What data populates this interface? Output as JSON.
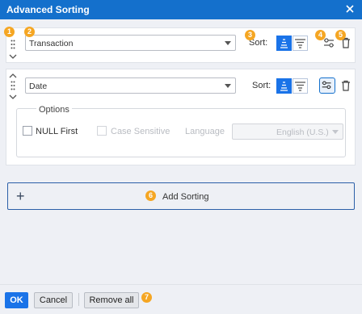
{
  "dialog": {
    "title": "Advanced Sorting",
    "close_icon": "close-icon"
  },
  "callouts": [
    "1",
    "2",
    "3",
    "4",
    "5",
    "6",
    "7"
  ],
  "sort_rows": [
    {
      "field": "Transaction",
      "sort_label": "Sort:",
      "order": "ascending",
      "options_open": false
    },
    {
      "field": "Date",
      "sort_label": "Sort:",
      "order": "ascending",
      "options_open": true,
      "options": {
        "legend": "Options",
        "null_first": {
          "label": "NULL First",
          "checked": false
        },
        "case_sensitive": {
          "label": "Case Sensitive",
          "checked": false,
          "enabled": false
        },
        "language": {
          "label": "Language",
          "value": "English (U.S.)",
          "enabled": false
        }
      }
    }
  ],
  "add_sorting": {
    "label": "Add Sorting"
  },
  "footer": {
    "ok_label": "OK",
    "cancel_label": "Cancel",
    "remove_all_label": "Remove all"
  },
  "colors": {
    "accent": "#1a73e8",
    "titlebar": "#1470cc",
    "callout": "#f5a623"
  }
}
